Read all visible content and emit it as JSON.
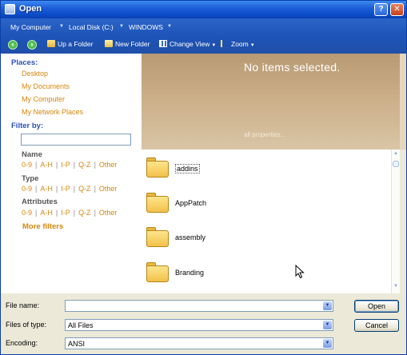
{
  "window": {
    "title": "Open"
  },
  "breadcrumb": [
    "My Computer",
    "Local Disk (C:)",
    "WINDOWS"
  ],
  "toolbar": {
    "back_icon": "back-arrow-icon",
    "forward_icon": "forward-arrow-icon",
    "up_folder": "Up a Folder",
    "new_folder": "New Folder",
    "change_view": "Change View",
    "zoom": "Zoom"
  },
  "places": {
    "header": "Places:",
    "items": [
      "Desktop",
      "My Documents",
      "My Computer",
      "My Network Places"
    ]
  },
  "filter": {
    "header": "Filter by:",
    "input_value": "",
    "name_header": "Name",
    "type_header": "Type",
    "attributes_header": "Attributes",
    "ranges": [
      "0-9",
      "A-H",
      "I-P",
      "Q-Z",
      "Other"
    ],
    "more": "More filters"
  },
  "preview": {
    "title": "No items selected.",
    "properties_link": "all properties..."
  },
  "files": [
    {
      "name": "addins",
      "selected": true
    },
    {
      "name": "AppPatch",
      "selected": false
    },
    {
      "name": "assembly",
      "selected": false
    },
    {
      "name": "Branding",
      "selected": false
    }
  ],
  "form": {
    "file_name_label": "File name:",
    "file_name_value": "",
    "files_of_type_label": "Files of type:",
    "files_of_type_value": "All Files",
    "encoding_label": "Encoding:",
    "encoding_value": "ANSI"
  },
  "buttons": {
    "open": "Open",
    "cancel": "Cancel"
  },
  "colors": {
    "title_bar": "#1e5fd8",
    "link_orange": "#d4870c",
    "section_blue": "#2a4fb8",
    "preview_tan": "#ccb08a"
  }
}
